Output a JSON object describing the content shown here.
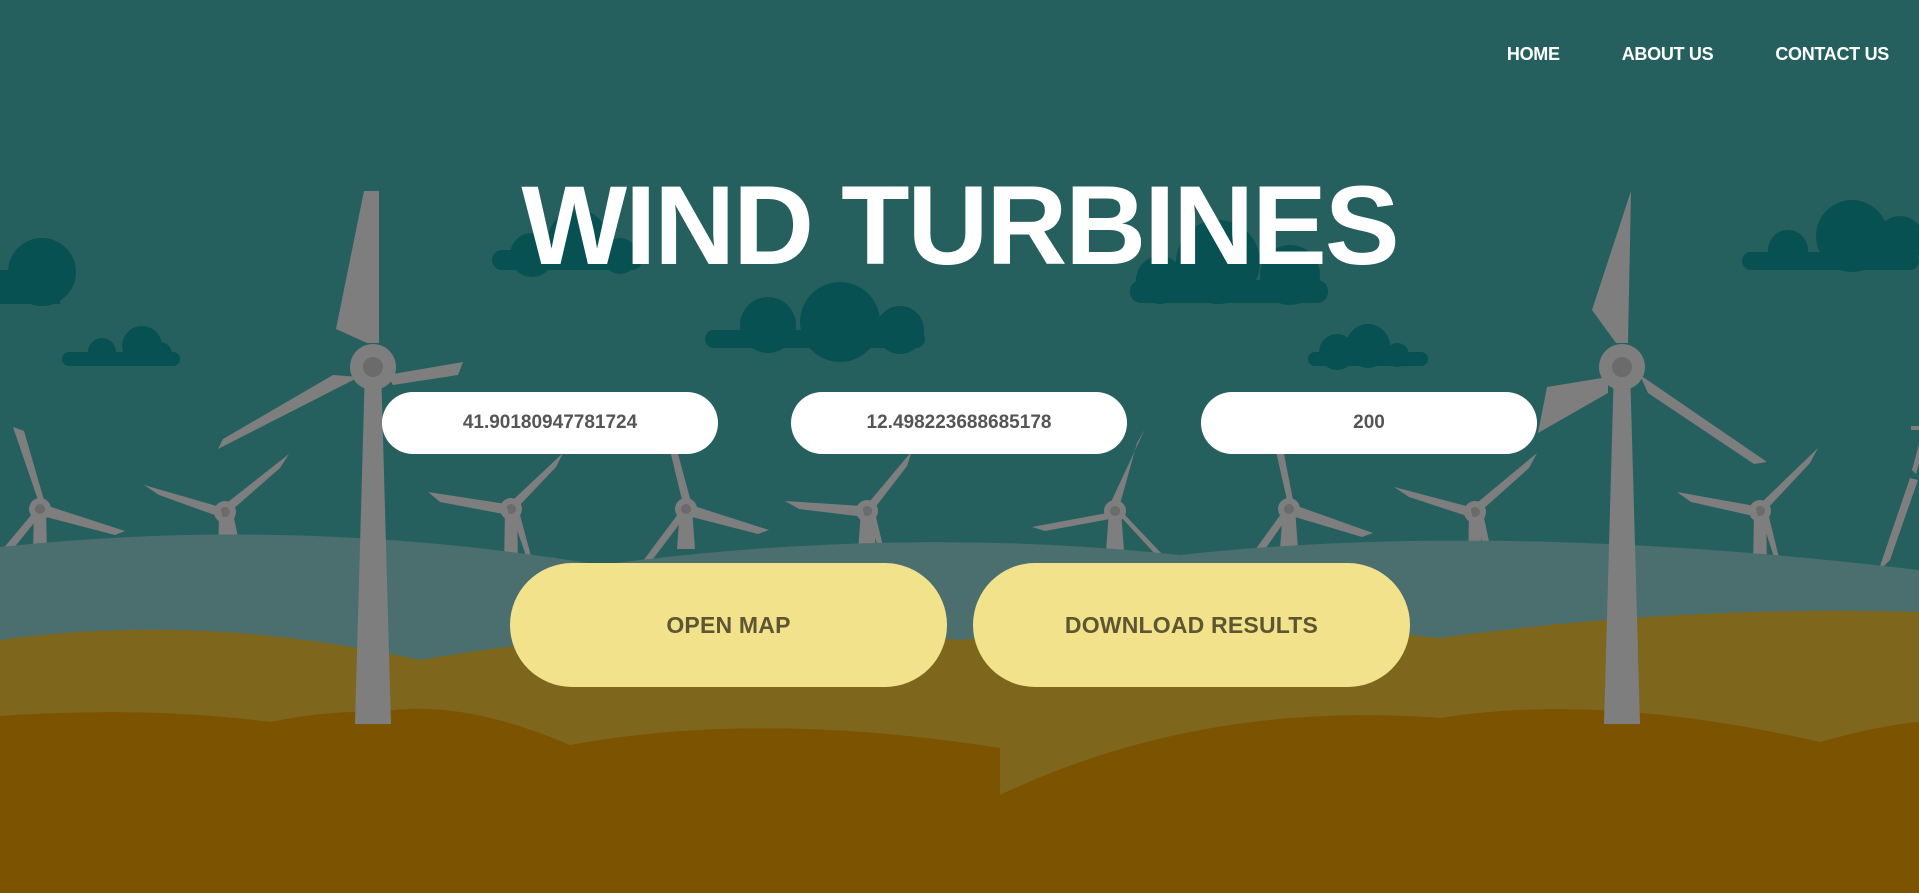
{
  "nav": {
    "home": "HOME",
    "about": "ABOUT US",
    "contact": "CONTACT US"
  },
  "hero": {
    "title": "WIND TURBINES"
  },
  "inputs": {
    "latitude": "41.90180947781724",
    "longitude": "12.498223688685178",
    "radius": "200"
  },
  "buttons": {
    "open_map": "OPEN MAP",
    "download": "DOWNLOAD RESULTS"
  },
  "colors": {
    "sky": "#25605f",
    "cloud": "#085152",
    "hill_far": "#4a6f6e",
    "field_mid": "#7e661c",
    "field_near": "#7c5300",
    "turbine": "#7e7e7e",
    "button": "#f1e28b",
    "button_text": "#5e5632",
    "text": "#ffffff"
  }
}
